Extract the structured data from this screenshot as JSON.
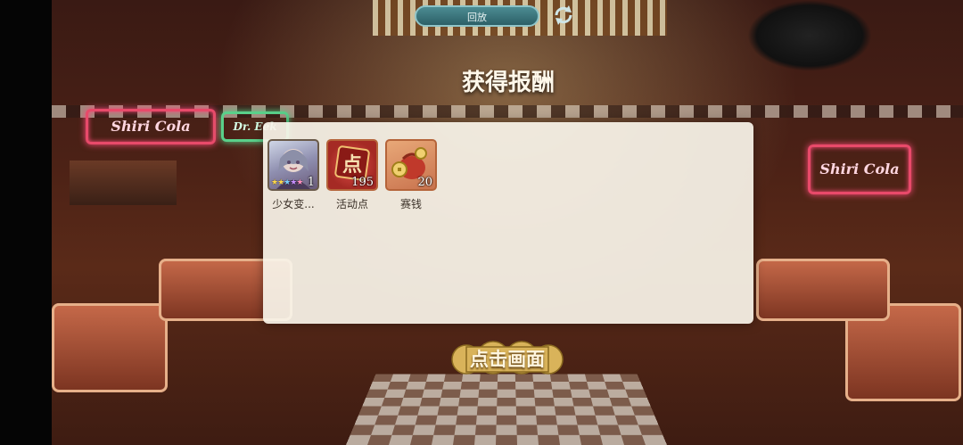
{
  "replay": {
    "label": "回放"
  },
  "reward_title": "获得报酬",
  "rewards": [
    {
      "name": "少女变...",
      "count": "1",
      "icon": "character-portrait-icon"
    },
    {
      "name": "活动点",
      "count": "195",
      "icon": "event-point-icon"
    },
    {
      "name": "赛钱",
      "count": "20",
      "icon": "coin-purse-icon"
    }
  ],
  "character_stars": 5,
  "tap_label": "点击画面",
  "signs": {
    "left": "Shiri Cola",
    "right": "Shiri Cola",
    "middle": "Dr. Eek"
  },
  "colors": {
    "accent_gold": "#d9b35a",
    "panel_bg": "#f8f3e8",
    "replay_teal": "#3c7a82"
  }
}
